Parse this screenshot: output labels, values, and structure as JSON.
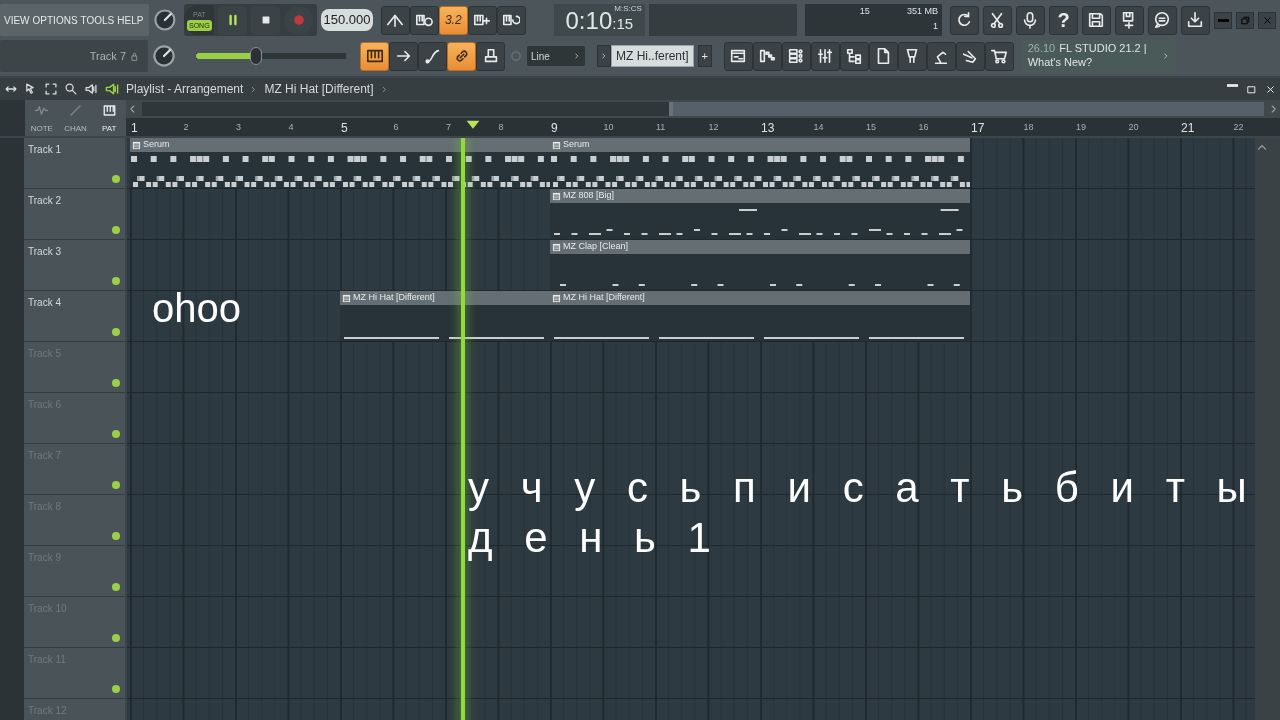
{
  "menu": [
    "VIEW",
    "OPTIONS",
    "TOOLS",
    "HELP"
  ],
  "hint": "Track 7",
  "mode_switch": [
    {
      "label": "PAT",
      "selected": false
    },
    {
      "label": "SONG",
      "selected": true
    }
  ],
  "transport": {
    "playing": true,
    "recording": false
  },
  "tempo": "150.000",
  "tools_row1": [
    {
      "on": false
    },
    {
      "on": false
    },
    {
      "label": "3.2",
      "on": true
    },
    {
      "on": false
    },
    {
      "on": false
    }
  ],
  "time": {
    "main": "0:10",
    "cs": ":15",
    "unit": "M:S:CS"
  },
  "cpu": {
    "voices": "15",
    "memory": "351 MB",
    "count": "1"
  },
  "help_glyph": "?",
  "master_volume": {
    "level": 0.4
  },
  "tools_row2": [
    {
      "on": true
    },
    {
      "on": false
    },
    {
      "on": false
    },
    {
      "on": true
    },
    {
      "on": false
    }
  ],
  "snap": "Line",
  "pattern": {
    "name": "MZ Hi..ferent]",
    "add": "+"
  },
  "news": {
    "time": "26.10",
    "title": "FL STUDIO 21.2 |",
    "link": "What's New?"
  },
  "playlist": {
    "title": "Playlist - Arrangement",
    "pattern": "MZ Hi Hat [Different]",
    "view_modes": [
      {
        "label": "NOTE",
        "selected": false
      },
      {
        "label": "CHAN",
        "selected": false
      },
      {
        "label": "PAT",
        "selected": true
      }
    ],
    "ruler": [
      "1",
      "2",
      "3",
      "4",
      "5",
      "6",
      "7",
      "8",
      "9",
      "10",
      "11",
      "12",
      "13",
      "14",
      "15",
      "16",
      "17",
      "18",
      "19",
      "20",
      "21",
      "22"
    ],
    "playhead": {
      "level": 0.298
    },
    "tracks": [
      {
        "name": "Track 1",
        "active": true,
        "muted": false,
        "lane": [
          {
            "kind": "synth",
            "name": "Serum",
            "wide": true
          },
          {
            "kind": "synth",
            "name": "Serum",
            "wide": true
          }
        ]
      },
      {
        "name": "Track 2",
        "active": true,
        "muted": false,
        "lane": [
          {
            "kind": "gap"
          },
          {
            "kind": "gap"
          },
          {
            "kind": "bass",
            "name": "MZ 808 [Big]",
            "wide": true
          }
        ]
      },
      {
        "name": "Track 3",
        "active": true,
        "muted": false,
        "lane": [
          {
            "kind": "gap"
          },
          {
            "kind": "gap"
          },
          {
            "kind": "clap",
            "name": "MZ Clap [Clean]",
            "wide": true
          }
        ]
      },
      {
        "name": "Track 4",
        "active": true,
        "muted": false,
        "lane": [
          {
            "kind": "gap"
          },
          {
            "kind": "hihat",
            "name": "MZ Hi Hat [Different]",
            "wide": false
          },
          {
            "kind": "hihat",
            "name": "MZ Hi Hat [Different]",
            "wide": true
          }
        ]
      },
      {
        "name": "Track 5",
        "active": false,
        "muted": false
      },
      {
        "name": "Track 6",
        "active": false,
        "muted": false
      },
      {
        "name": "Track 7",
        "active": false,
        "muted": false
      },
      {
        "name": "Track 8",
        "active": false,
        "muted": false
      },
      {
        "name": "Track 9",
        "active": false,
        "muted": false
      },
      {
        "name": "Track 10",
        "active": false,
        "muted": false
      },
      {
        "name": "Track 11",
        "active": false,
        "muted": false
      },
      {
        "name": "Track 12",
        "active": false
      }
    ]
  },
  "captions": [
    {
      "text": "ohoo",
      "kind": "small"
    },
    {
      "text": "у ч у с ь п и с а т ь б и т ы",
      "kind": "large"
    },
    {
      "text": "д е н ь 1",
      "kind": "large2"
    }
  ]
}
